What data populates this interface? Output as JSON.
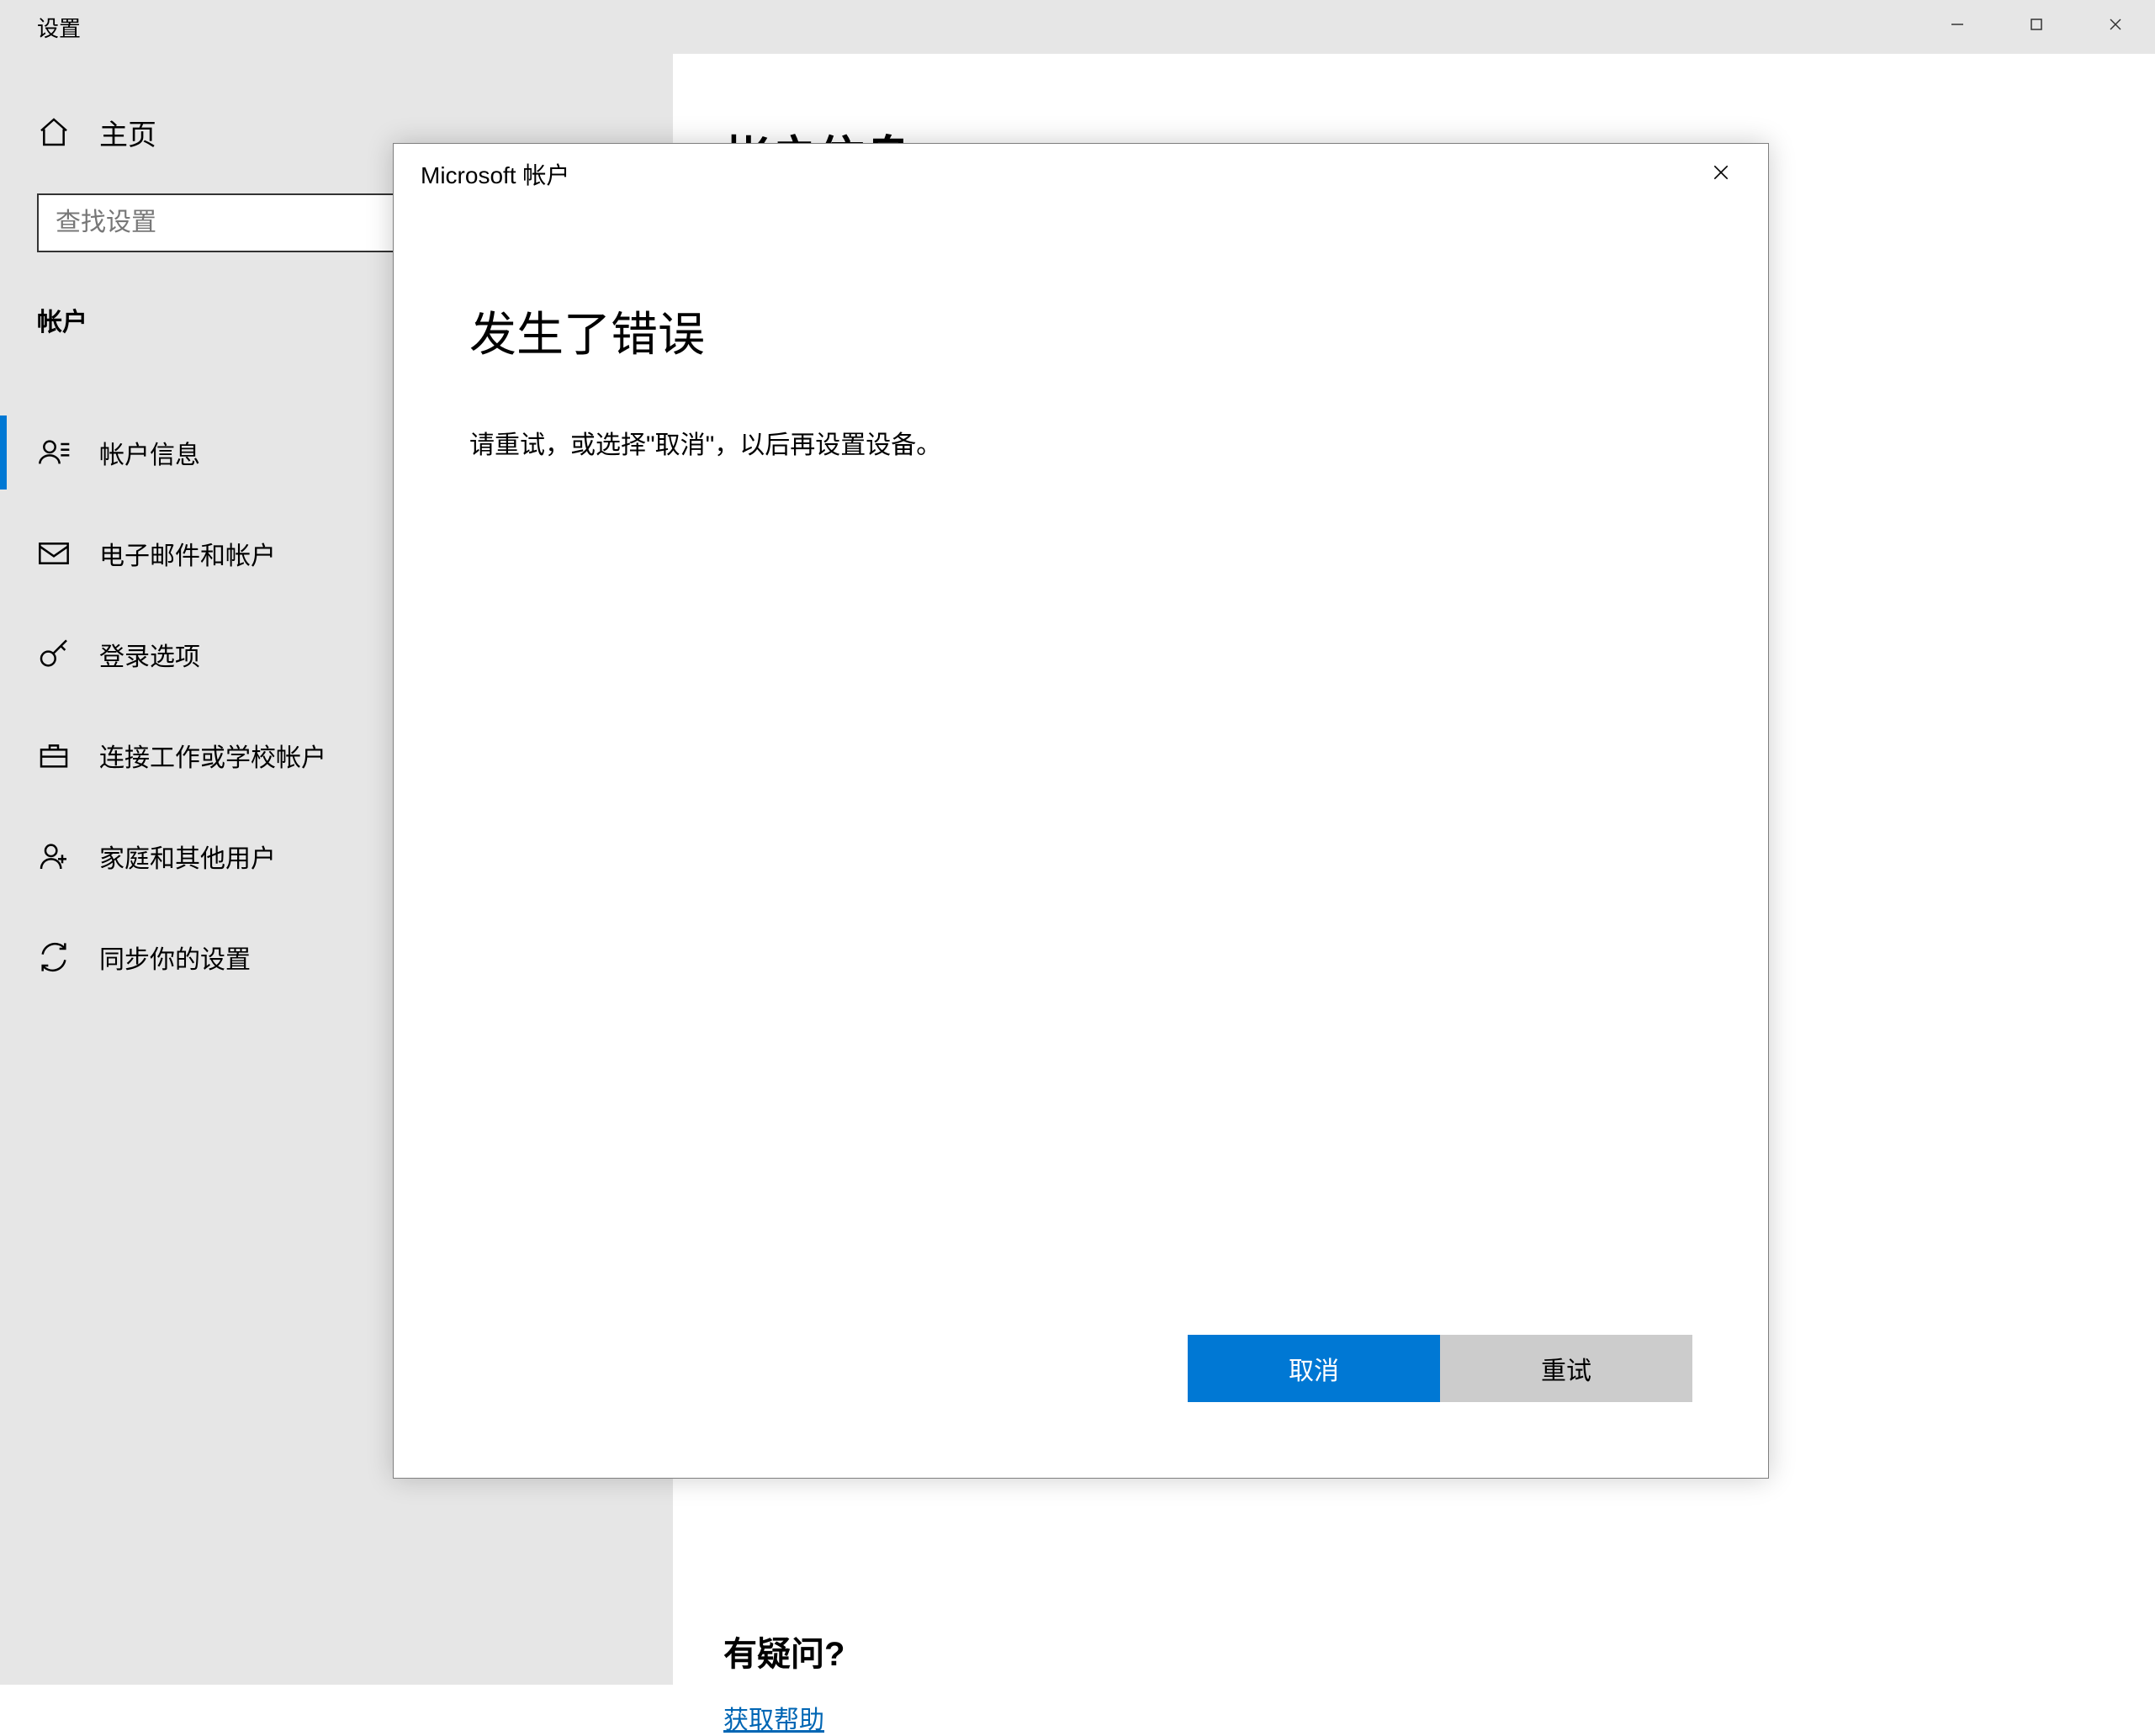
{
  "window": {
    "title": "设置"
  },
  "sidebar": {
    "home_label": "主页",
    "search_placeholder": "查找设置",
    "category_label": "帐户",
    "items": [
      {
        "label": "帐户信息",
        "icon": "person-card-icon",
        "selected": true
      },
      {
        "label": "电子邮件和帐户",
        "icon": "mail-icon",
        "selected": false
      },
      {
        "label": "登录选项",
        "icon": "key-icon",
        "selected": false
      },
      {
        "label": "连接工作或学校帐户",
        "icon": "briefcase-icon",
        "selected": false
      },
      {
        "label": "家庭和其他用户",
        "icon": "people-icon",
        "selected": false
      },
      {
        "label": "同步你的设置",
        "icon": "sync-icon",
        "selected": false
      }
    ]
  },
  "main": {
    "page_title": "帐户信息",
    "help_heading": "有疑问?",
    "help_link": "获取帮助"
  },
  "modal": {
    "title": "Microsoft 帐户",
    "heading": "发生了错误",
    "message": "请重试，或选择\"取消\"，以后再设置设备。",
    "primary_button": "取消",
    "secondary_button": "重试"
  }
}
